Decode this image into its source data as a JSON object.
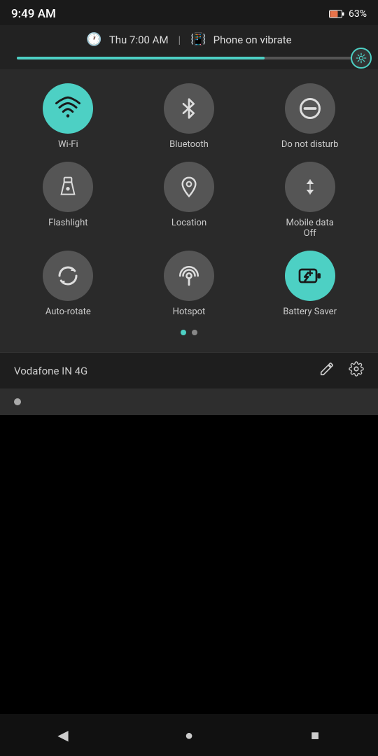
{
  "statusBar": {
    "time": "9:49 AM",
    "battery": "63%"
  },
  "notification": {
    "alarm": "Thu 7:00 AM",
    "vibrate": "Phone on vibrate"
  },
  "brightness": {
    "fillPercent": 72
  },
  "tiles": [
    {
      "id": "wifi",
      "label": "Wi-Fi",
      "icon": "wifi",
      "active": true
    },
    {
      "id": "bluetooth",
      "label": "Bluetooth",
      "icon": "bluetooth",
      "active": false
    },
    {
      "id": "dnd",
      "label": "Do not disturb",
      "icon": "dnd",
      "active": false
    },
    {
      "id": "flashlight",
      "label": "Flashlight",
      "icon": "flashlight",
      "active": false
    },
    {
      "id": "location",
      "label": "Location",
      "icon": "location",
      "active": false
    },
    {
      "id": "mobiledata",
      "label": "Mobile data\nOff",
      "icon": "mobiledata",
      "active": false
    },
    {
      "id": "autorotate",
      "label": "Auto-rotate",
      "icon": "autorotate",
      "active": false
    },
    {
      "id": "hotspot",
      "label": "Hotspot",
      "icon": "hotspot",
      "active": false
    },
    {
      "id": "batterysaver",
      "label": "Battery Saver",
      "icon": "batterysaver",
      "active": true
    }
  ],
  "pageIndicators": [
    {
      "active": true
    },
    {
      "active": false
    }
  ],
  "bottomBar": {
    "carrier": "Vodafone IN 4G",
    "editLabel": "✏",
    "settingsLabel": "⚙"
  },
  "navBar": {
    "back": "◀",
    "home": "●",
    "recents": "■"
  }
}
